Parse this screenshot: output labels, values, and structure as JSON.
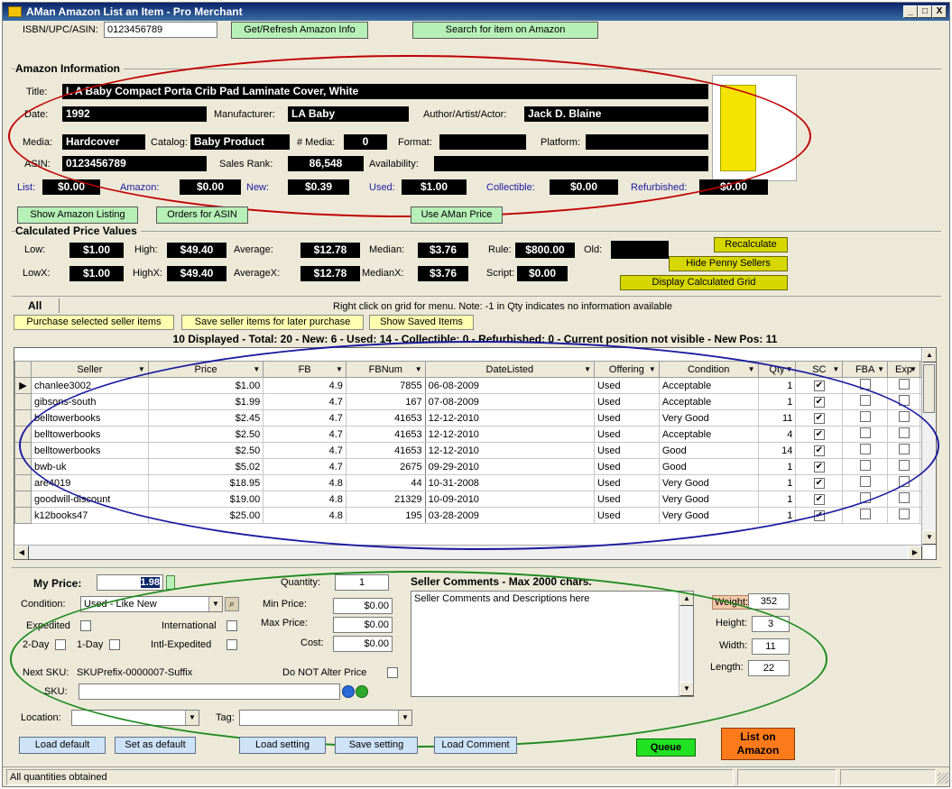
{
  "window": {
    "title": "AMan Amazon List an Item - Pro Merchant",
    "min": "_",
    "max": "□",
    "close": "X"
  },
  "top": {
    "isbn_label": "ISBN/UPC/ASIN:",
    "isbn_value": "0123456789",
    "refresh_btn": "Get/Refresh Amazon Info",
    "search_btn": "Search for item on Amazon"
  },
  "amazon": {
    "section_title": "Amazon Information",
    "title_label": "Title:",
    "title_value": "L A Baby Compact Porta Crib Pad Laminate Cover, White",
    "date_label": "Date:",
    "date_value": "1992",
    "manufacturer_label": "Manufacturer:",
    "manufacturer_value": "LA Baby",
    "author_label": "Author/Artist/Actor:",
    "author_value": "Jack D. Blaine",
    "media_label": "Media:",
    "media_value": "Hardcover",
    "catalog_label": "Catalog:",
    "catalog_value": "Baby Product",
    "nmedia_label": "# Media:",
    "nmedia_value": "0",
    "format_label": "Format:",
    "format_value": "",
    "platform_label": "Platform:",
    "platform_value": "",
    "asin_label": "ASIN:",
    "asin_value": "0123456789",
    "salesrank_label": "Sales Rank:",
    "salesrank_value": "86,548",
    "availability_label": "Availability:",
    "availability_value": "",
    "list_label": "List:",
    "list_value": "$0.00",
    "amazon_label": "Amazon:",
    "amazon_value": "$0.00",
    "new_label": "New:",
    "new_value": "$0.39",
    "used_label": "Used:",
    "used_value": "$1.00",
    "collectible_label": "Collectible:",
    "collectible_value": "$0.00",
    "refurb_label": "Refurbished:",
    "refurb_value": "$0.00"
  },
  "actions": {
    "show_listing": "Show Amazon Listing",
    "orders": "Orders for ASIN",
    "use_price": "Use AMan Price"
  },
  "calc": {
    "section_title": "Calculated Price Values",
    "low_label": "Low:",
    "low_value": "$1.00",
    "high_label": "High:",
    "high_value": "$49.40",
    "avg_label": "Average:",
    "avg_value": "$12.78",
    "median_label": "Median:",
    "median_value": "$3.76",
    "rule_label": "Rule:",
    "rule_value": "$800.00",
    "old_label": "Old:",
    "old_value": "",
    "lowx_label": "LowX:",
    "lowx_value": "$1.00",
    "highx_label": "HighX:",
    "highx_value": "$49.40",
    "avgx_label": "AverageX:",
    "avgx_value": "$12.78",
    "medianx_label": "MedianX:",
    "medianx_value": "$3.76",
    "script_label": "Script:",
    "script_value": "$0.00",
    "recalc_btn": "Recalculate",
    "hide_penny_btn": "Hide Penny Sellers",
    "display_grid_btn": "Display Calculated Grid"
  },
  "grid_toolbar": {
    "tab_all": "All",
    "note": "Right click on grid for menu. Note: -1 in Qty indicates no information available",
    "purchase_btn": "Purchase selected seller items",
    "save_btn": "Save seller items for later purchase",
    "show_saved_btn": "Show Saved Items"
  },
  "grid": {
    "summary": "10 Displayed - Total: 20 - New: 6 - Used: 14 - Collectible: 0 - Refurbished: 0 - Current position not visible - New Pos: 11",
    "columns": [
      "Seller",
      "Price",
      "FB",
      "FBNum",
      "DateListed",
      "Offering",
      "Condition",
      "Qty",
      "SC",
      "FBA",
      "Exp"
    ],
    "rows": [
      {
        "seller": "chanlee3002",
        "price": "$1.00",
        "fb": "4.9",
        "fbnum": "7855",
        "date": "06-08-2009",
        "offering": "Used",
        "condition": "Acceptable",
        "qty": "1",
        "sc": "✔",
        "fba": "",
        "exp": ""
      },
      {
        "seller": "gibsons-south",
        "price": "$1.99",
        "fb": "4.7",
        "fbnum": "167",
        "date": "07-08-2009",
        "offering": "Used",
        "condition": "Acceptable",
        "qty": "1",
        "sc": "✔",
        "fba": "",
        "exp": ""
      },
      {
        "seller": "belltowerbooks",
        "price": "$2.45",
        "fb": "4.7",
        "fbnum": "41653",
        "date": "12-12-2010",
        "offering": "Used",
        "condition": "Very Good",
        "qty": "11",
        "sc": "✔",
        "fba": "",
        "exp": ""
      },
      {
        "seller": "belltowerbooks",
        "price": "$2.50",
        "fb": "4.7",
        "fbnum": "41653",
        "date": "12-12-2010",
        "offering": "Used",
        "condition": "Acceptable",
        "qty": "4",
        "sc": "✔",
        "fba": "",
        "exp": ""
      },
      {
        "seller": "belltowerbooks",
        "price": "$2.50",
        "fb": "4.7",
        "fbnum": "41653",
        "date": "12-12-2010",
        "offering": "Used",
        "condition": "Good",
        "qty": "14",
        "sc": "✔",
        "fba": "",
        "exp": ""
      },
      {
        "seller": "bwb-uk",
        "price": "$5.02",
        "fb": "4.7",
        "fbnum": "2675",
        "date": "09-29-2010",
        "offering": "Used",
        "condition": "Good",
        "qty": "1",
        "sc": "✔",
        "fba": "",
        "exp": ""
      },
      {
        "seller": "are4019",
        "price": "$18.95",
        "fb": "4.8",
        "fbnum": "44",
        "date": "10-31-2008",
        "offering": "Used",
        "condition": "Very Good",
        "qty": "1",
        "sc": "✔",
        "fba": "",
        "exp": ""
      },
      {
        "seller": "goodwill-discount",
        "price": "$19.00",
        "fb": "4.8",
        "fbnum": "21329",
        "date": "10-09-2010",
        "offering": "Used",
        "condition": "Very Good",
        "qty": "1",
        "sc": "✔",
        "fba": "",
        "exp": ""
      },
      {
        "seller": "k12books47",
        "price": "$25.00",
        "fb": "4.8",
        "fbnum": "195",
        "date": "03-28-2009",
        "offering": "Used",
        "condition": "Very Good",
        "qty": "1",
        "sc": "✔",
        "fba": "",
        "exp": ""
      }
    ]
  },
  "listing": {
    "myprice_label": "My Price:",
    "myprice_value": "1.98",
    "quantity_label": "Quantity:",
    "quantity_value": "1",
    "condition_label": "Condition:",
    "condition_value": "Used - Like New",
    "expedited_label": "Expedited",
    "international_label": "International",
    "twoday_label": "2-Day",
    "oneday_label": "1-Day",
    "intlexp_label": "Intl-Expedited",
    "minprice_label": "Min Price:",
    "minprice_value": "$0.00",
    "maxprice_label": "Max Price:",
    "maxprice_value": "$0.00",
    "cost_label": "Cost:",
    "cost_value": "$0.00",
    "nextsku_label": "Next SKU:",
    "nextsku_value": "SKUPrefix-0000007-Suffix",
    "donotalter_label": "Do NOT Alter Price",
    "sku_label": "SKU:",
    "sku_value": "",
    "comments_title": "Seller Comments - Max 2000 chars.",
    "comments_value": "Seller Comments and Descriptions here",
    "weight_label": "Weight:",
    "weight_value": "352",
    "height_label": "Height:",
    "height_value": "3",
    "width_label": "Width:",
    "width_value": "11",
    "length_label": "Length:",
    "length_value": "22",
    "location_label": "Location:",
    "location_value": "",
    "tag_label": "Tag:",
    "tag_value": ""
  },
  "bottom": {
    "load_default": "Load default",
    "set_default": "Set as default",
    "load_setting": "Load setting",
    "save_setting": "Save setting",
    "load_comment": "Load Comment",
    "queue": "Queue",
    "list_on_amazon": "List on Amazon"
  },
  "status": {
    "text": "All quantities obtained"
  },
  "colors": {
    "annot_red": "#c00000",
    "annot_blue": "#1a1aa0",
    "annot_green": "#1c8a1c"
  }
}
